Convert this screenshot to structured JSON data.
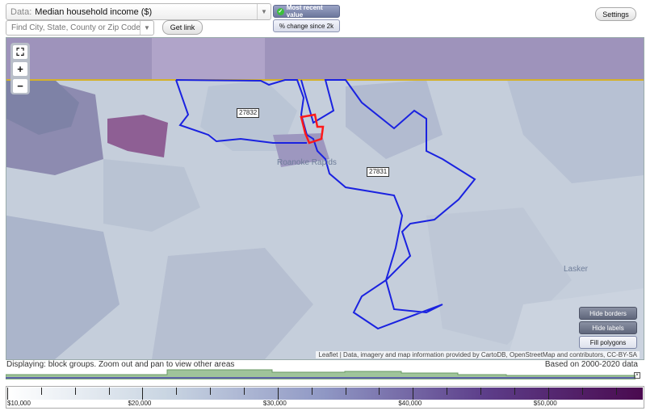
{
  "toolbar": {
    "data_prefix": "Data:",
    "data_value": "Median household income ($)",
    "search_placeholder": "Find City, State, County or Zip Code",
    "get_link_label": "Get link",
    "most_recent_label": "Most recent value",
    "pct_change_label": "% change since 2k",
    "settings_label": "Settings"
  },
  "map": {
    "zoom_in_label": "+",
    "zoom_out_label": "−",
    "zip_labels": [
      "27832",
      "27831"
    ],
    "town_labels": [
      "Roanoke Rapids",
      "Lasker"
    ],
    "buttons": {
      "hide_borders": "Hide borders",
      "hide_labels": "Hide labels",
      "fill_polygons": "Fill polygons"
    },
    "attribution": {
      "leaflet": "Leaflet",
      "text": "| Data, imagery and map information provided by",
      "cartodb": "CartoDB",
      "osm": "OpenStreetMap",
      "tail": "and contributors, CC-BY-SA"
    },
    "colors": {
      "state_border": "#d4b12a",
      "zip_outline": "#1a22e0",
      "highlight": "#ff1a1a"
    }
  },
  "status": {
    "left": "Displaying: block groups. Zoom out and pan to view other areas",
    "right": "Based on 2000-2020 data"
  },
  "legend": {
    "labels": [
      "$10,000",
      "$20,000",
      "$30,000",
      "$40,000",
      "$50,000"
    ],
    "values": [
      10000,
      20000,
      30000,
      40000,
      50000
    ],
    "min": 10000,
    "max": 57000,
    "gradient": [
      "#ffffff",
      "#c9d5e2",
      "#8f97c4",
      "#5d3e8a",
      "#4a0a4f"
    ]
  }
}
